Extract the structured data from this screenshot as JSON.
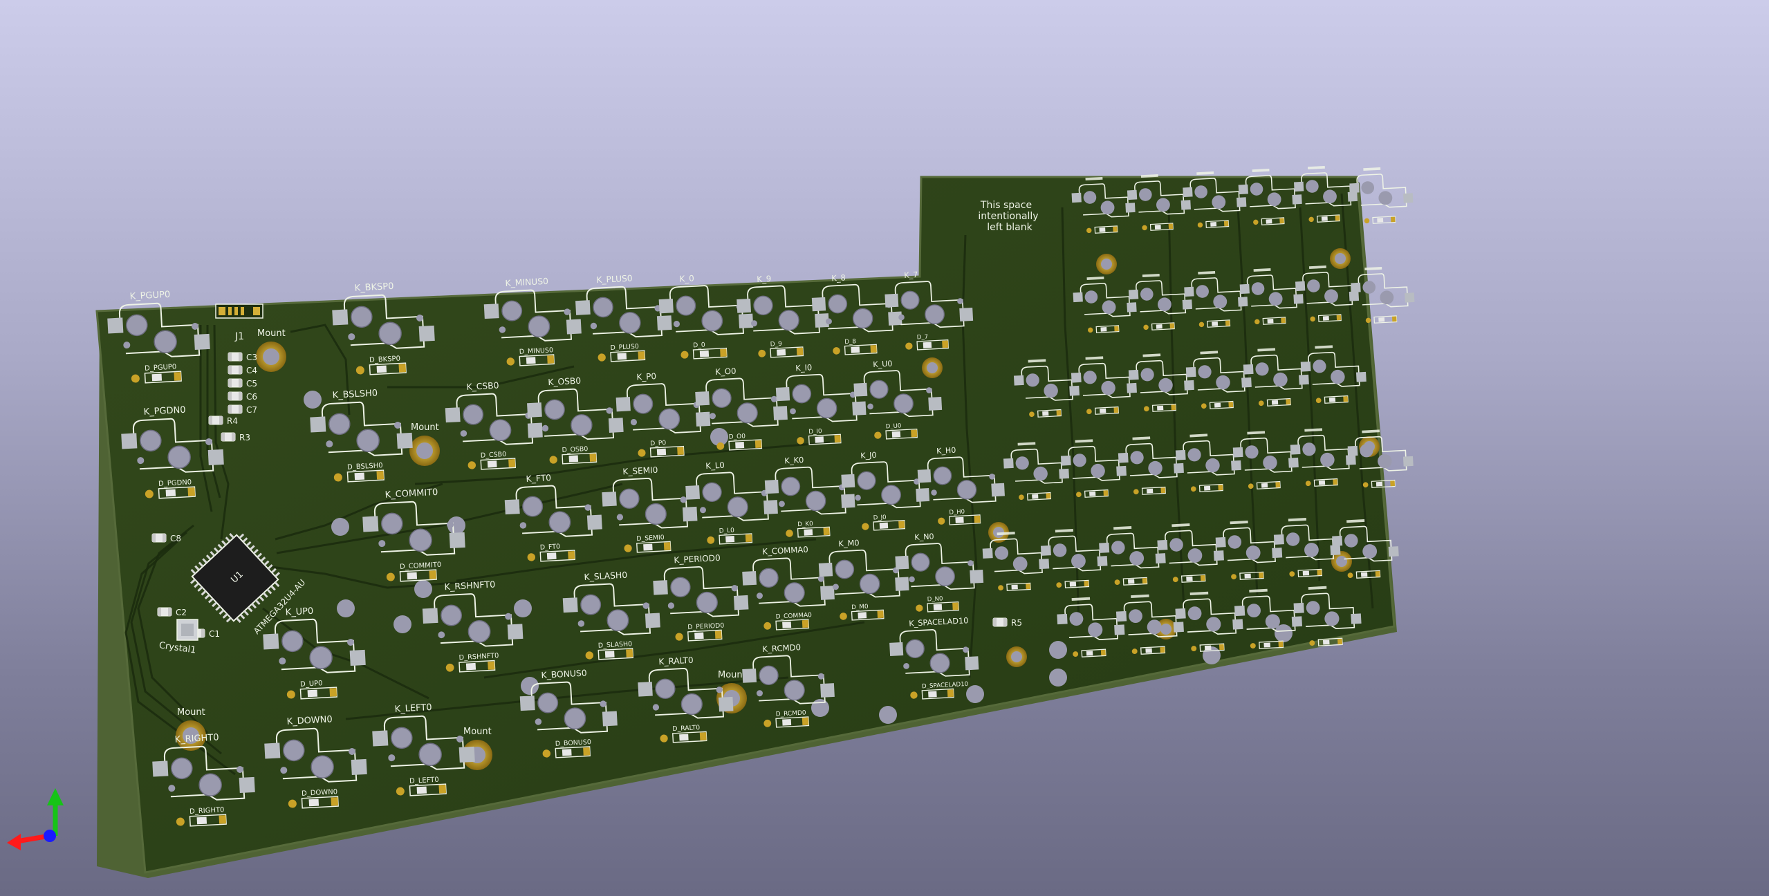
{
  "colors": {
    "board": "#2c4118",
    "board_dark": "#1f3010",
    "board_edge": "#566a3a",
    "silkscreen": "#eef3e6",
    "pad_gray": "#b8bcc2",
    "gold": "#c9a227",
    "gold_dark": "#7a5c10",
    "hole": "#9a9aae",
    "axis_x": "#ff1a1a",
    "axis_y": "#16c416",
    "axis_z": "#1a1aff"
  },
  "board": {
    "notice_lines": [
      "This space",
      "intentionally",
      "left blank"
    ],
    "connector_label": "J1",
    "crystal_label": "Crystal1",
    "mcu_label": "U1",
    "mcu_part": "ATMEGA32U4-AU",
    "passives": [
      "C3",
      "C4",
      "C5",
      "C6",
      "C7",
      "R4",
      "R3",
      "C8",
      "C2",
      "C1",
      "R5"
    ],
    "mount_label": "Mount"
  },
  "keys": [
    {
      "label": "K_PGUP0",
      "diode": "D_PGUP0"
    },
    {
      "label": "K_PGDN0",
      "diode": "D_PGDN0"
    },
    {
      "label": "K_BKSP0",
      "diode": "D_BKSP0"
    },
    {
      "label": "K_BSLSH0",
      "diode": "D_BSLSH0"
    },
    {
      "label": "K_MINUS0",
      "diode": "D_MINUS0"
    },
    {
      "label": "K_PLUS0",
      "diode": "D_PLUS0"
    },
    {
      "label": "K_0",
      "diode": "D_0"
    },
    {
      "label": "K_9",
      "diode": "D_9"
    },
    {
      "label": "K_8",
      "diode": "D_8"
    },
    {
      "label": "K_7",
      "diode": "D_7"
    },
    {
      "label": "K_CSB0",
      "diode": "D_CSB0"
    },
    {
      "label": "K_OSB0",
      "diode": "D_OSB0"
    },
    {
      "label": "K_P0",
      "diode": "D_P0"
    },
    {
      "label": "K_O0",
      "diode": "D_O0"
    },
    {
      "label": "K_I0",
      "diode": "D_I0"
    },
    {
      "label": "K_U0",
      "diode": "D_U0"
    },
    {
      "label": "K_COMMIT0",
      "diode": "D_COMMIT0"
    },
    {
      "label": "K_FT0",
      "diode": "D_FT0"
    },
    {
      "label": "K_SEMI0",
      "diode": "D_SEMI0"
    },
    {
      "label": "K_L0",
      "diode": "D_L0"
    },
    {
      "label": "K_K0",
      "diode": "D_K0"
    },
    {
      "label": "K_J0",
      "diode": "D_J0"
    },
    {
      "label": "K_H0",
      "diode": "D_H0"
    },
    {
      "label": "K_RSHNFT0",
      "diode": "D_RSHNFT0"
    },
    {
      "label": "K_SLASH0",
      "diode": "D_SLASH0"
    },
    {
      "label": "K_PERIOD0",
      "diode": "D_PERIOD0"
    },
    {
      "label": "K_COMMA0",
      "diode": "D_COMMA0"
    },
    {
      "label": "K_M0",
      "diode": "D_M0"
    },
    {
      "label": "K_N0",
      "diode": "D_N0"
    },
    {
      "label": "K_UP0",
      "diode": "D_UP0"
    },
    {
      "label": "K_BONUS0",
      "diode": "D_BONUS0"
    },
    {
      "label": "K_RALT0",
      "diode": "D_RALT0"
    },
    {
      "label": "K_RCMD0",
      "diode": "D_RCMD0"
    },
    {
      "label": "K_SPACELAD10",
      "diode": "D_SPACELAD10"
    },
    {
      "label": "K_LEFT0",
      "diode": "D_LEFT0"
    },
    {
      "label": "K_DOWN0",
      "diode": "D_DOWN0"
    },
    {
      "label": "K_RIGHT0",
      "diode": "D_RIGHT0"
    }
  ]
}
